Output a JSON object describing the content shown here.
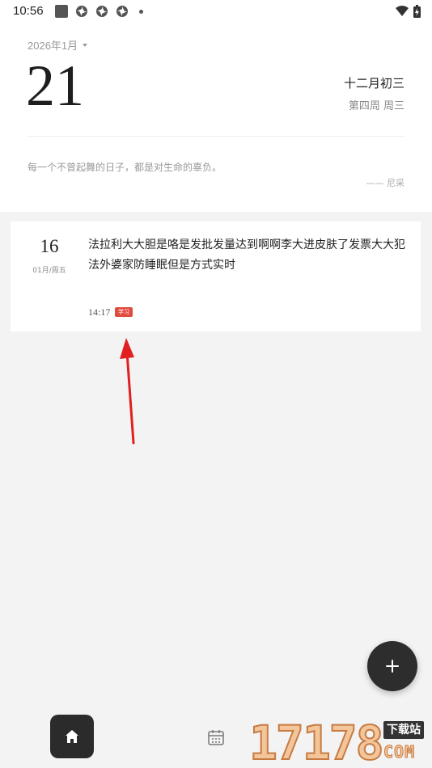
{
  "status_bar": {
    "time": "10:56",
    "icons": [
      "square-icon",
      "pinwheel-icon",
      "pinwheel-icon",
      "pinwheel-icon",
      "dot-icon"
    ],
    "right_icons": [
      "wifi-icon",
      "battery-icon"
    ]
  },
  "header": {
    "month_selector": "2026年1月",
    "day_number": "21",
    "lunar_date": "十二月初三",
    "week_info": "第四周 周三",
    "quote": "每一个不曾起舞的日子，都是对生命的辜负。",
    "quote_author": "—— 尼采"
  },
  "entries": [
    {
      "day": "16",
      "date_sub": "01月/周五",
      "text": "法拉利大大胆是咯是发批发量达到啊啊李大进皮肤了发票大大犯法外婆家防睡眠但是方式实时",
      "time": "14:17",
      "tag": "学习",
      "tag_color": "#e04a3f"
    }
  ],
  "fab": {
    "icon": "plus-icon"
  },
  "bottom_nav": {
    "items": [
      {
        "icon": "home-icon",
        "active": true
      },
      {
        "icon": "calendar-icon",
        "active": false
      }
    ]
  },
  "watermark": {
    "number": "17178",
    "badge": "下载站",
    "suffix": "COM"
  },
  "colors": {
    "background": "#f3f3f3",
    "card": "#ffffff",
    "accent_dark": "#2d2d2d",
    "tag_red": "#e04a3f",
    "arrow_red": "#e02020"
  }
}
